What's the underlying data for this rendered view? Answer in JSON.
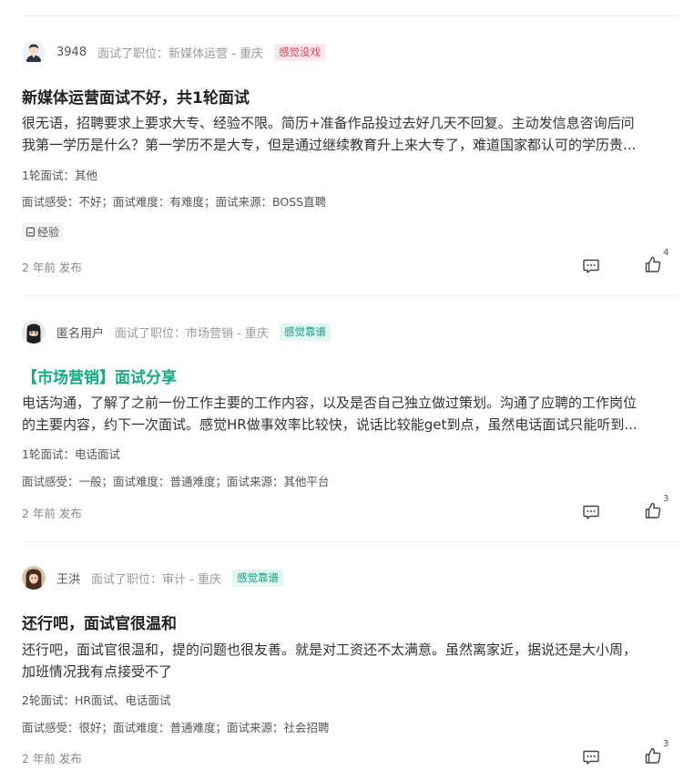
{
  "posts": [
    {
      "username": "3948",
      "position": "面试了职位：新媒体运营 - 重庆",
      "feel": "感觉没戏",
      "feel_color": "#e0435b",
      "feel_bg": "#fde8ec",
      "title": "新媒体运营面试不好，共1轮面试",
      "title_color": "#222222",
      "body_lines": [
        "很无语，招聘要求上要求大专、经验不限。简历+准备作品投过去好几天不回复。主动发信息咨询后问",
        "我第一学历是什么？第一学历不是大专，但是通过继续教育升上来大专了，难道国家都认可的学历贵..."
      ],
      "rounds": "1轮面试：其他",
      "details": "面试感受：不好；面试难度：有难度；面试来源：BOSS直聘",
      "tag": "经验",
      "tag_icon": "bookmark-icon",
      "published": "2 年前 发布",
      "likes": "4"
    },
    {
      "username": "匿名用户",
      "position": "面试了职位：市场营销 - 重庆",
      "feel": "感觉靠谱",
      "feel_color": "#15a07f",
      "feel_bg": "#e3f6f1",
      "title": "【市场营销】面试分享",
      "title_color": "#1aa786",
      "body_lines": [
        "电话沟通，了解了之前一份工作主要的工作内容，以及是否自己独立做过策划。沟通了应聘的工作岗位",
        "的主要内容，约下一次面试。感觉HR做事效率比较快，说话比较能get到点，虽然电话面试只能听到..."
      ],
      "rounds": "1轮面试：电话面试",
      "details": "面试感受：一般；面试难度：普通难度；面试来源：其他平台",
      "published": "2 年前 发布",
      "likes": "3"
    },
    {
      "username": "王洪",
      "position": "面试了职位：审计 - 重庆",
      "feel": "感觉靠谱",
      "feel_color": "#15a07f",
      "feel_bg": "#e3f6f1",
      "title": "还行吧，面试官很温和",
      "title_color": "#222222",
      "body_lines": [
        "还行吧，面试官很温和，提的问题也很友善。就是对工资还不太满意。虽然离家近，据说还是大小周，",
        "加班情况我有点接受不了"
      ],
      "rounds": "2轮面试：HR面试、电话面试",
      "details": "面试感受：很好；面试难度：普通难度；面试来源：社会招聘",
      "published": "2 年前 发布",
      "likes": "3"
    }
  ],
  "icons": {
    "comment": "comment-icon",
    "like": "thumbs-up-icon"
  }
}
